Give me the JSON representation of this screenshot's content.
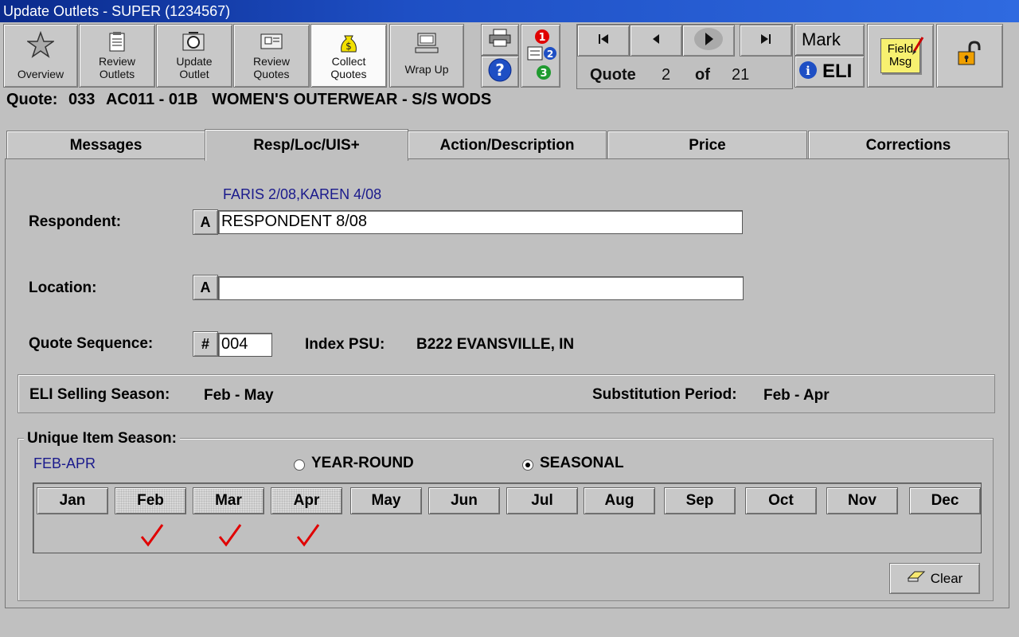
{
  "window": {
    "title": "Update Outlets - SUPER (1234567)"
  },
  "toolbar": {
    "overview": "Overview",
    "review_outlets": "Review Outlets",
    "update_outlet": "Update Outlet",
    "review_quotes": "Review Quotes",
    "collect_quotes": "Collect Quotes",
    "wrap_up": "Wrap Up",
    "mark": "Mark",
    "eli": "ELI",
    "field_msg": "Field Msg"
  },
  "navigator": {
    "quote_label": "Quote",
    "current": "2",
    "of_label": "of",
    "total": "21"
  },
  "quote_header": {
    "label": "Quote:",
    "number": "033",
    "code": "AC011 - 01B",
    "description": "WOMEN'S OUTERWEAR - S/S WODS"
  },
  "tabs": [
    "Messages",
    "Resp/Loc/UIS+",
    "Action/Description",
    "Price",
    "Corrections"
  ],
  "form": {
    "history_note": "FARIS 2/08,KAREN 4/08",
    "respondent_label": "Respondent:",
    "respondent_btn": "A",
    "respondent_value": "RESPONDENT 8/08",
    "location_label": "Location:",
    "location_btn": "A",
    "location_value": "",
    "sequence_label": "Quote Sequence:",
    "sequence_btn": "#",
    "sequence_value": "004",
    "index_psu_label": "Index PSU:",
    "index_psu_value": "B222 EVANSVILLE, IN"
  },
  "season": {
    "eli_label": "ELI Selling Season:",
    "eli_value": "Feb - May",
    "substitution_label": "Substitution Period:",
    "substitution_value": "Feb - Apr"
  },
  "unique_item": {
    "group_label": "Unique Item Season:",
    "range": "FEB-APR",
    "option_year_round": "YEAR-ROUND",
    "option_seasonal": "SEASONAL",
    "selected": "SEASONAL",
    "months": [
      "Jan",
      "Feb",
      "Mar",
      "Apr",
      "May",
      "Jun",
      "Jul",
      "Aug",
      "Sep",
      "Oct",
      "Nov",
      "Dec"
    ],
    "checked_months": [
      "Feb",
      "Mar",
      "Apr"
    ],
    "clear_label": "Clear"
  },
  "colors": {
    "title_bar": "#1e4fc4",
    "note_text": "#1a1a8c",
    "check": "#e00000"
  }
}
